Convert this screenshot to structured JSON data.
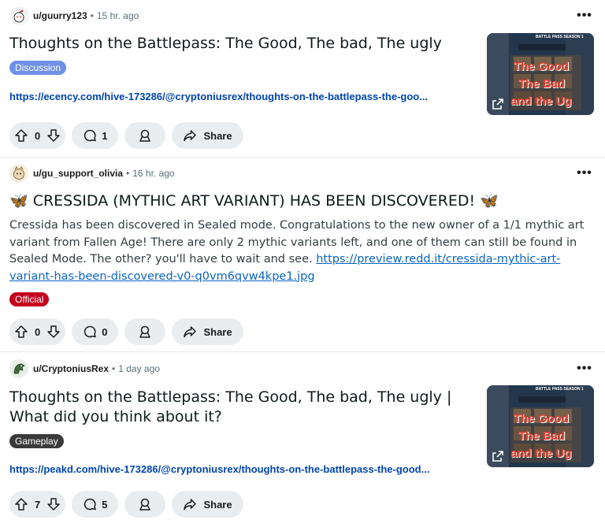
{
  "posts": [
    {
      "username": "u/guurry123",
      "time": "15 hr. ago",
      "title": "Thoughts on the Battlepass: The Good, The bad, The ugly",
      "flair": {
        "label": "Discussion",
        "color": "#6e90e6"
      },
      "link": "https://ecency.com/hive-173286/@cryptoniusrex/thoughts-on-the-battlepass-the-goo...",
      "thumbnail": {
        "banner": "BATTLE PASS SEASON 1",
        "lines": [
          "The Good",
          "The Bad",
          "and the Ug"
        ]
      },
      "votes": "0",
      "comments": "1",
      "share_label": "Share"
    },
    {
      "username": "u/gu_support_olivia",
      "time": "16 hr. ago",
      "title": "🦋 CRESSIDA (MYTHIC ART VARIANT) HAS BEEN DISCOVERED! 🦋",
      "body_text": "Cressida has been discovered in Sealed mode. Congratulations to the new owner of a 1/1 mythic art variant from Fallen Age! There are only 2 mythic variants left, and one of them can still be found in Sealed Mode. The other? you'll have to wait and see. ",
      "body_link": "https://preview.redd.it/cressida-mythic-art-variant-has-been-discovered-v0-q0vm6qvw4kpe1.jpg",
      "flair": {
        "label": "Official",
        "color": "#c4001d"
      },
      "votes": "0",
      "comments": "0",
      "share_label": "Share"
    },
    {
      "username": "u/CryptoniusRex",
      "time": "1 day ago",
      "title": "Thoughts on the Battlepass: The Good, The bad, The ugly | What did you think about it?",
      "flair": {
        "label": "Gameplay",
        "color": "#3b3b3b"
      },
      "link": "https://peakd.com/hive-173286/@cryptoniusrex/thoughts-on-the-battlepass-the-good...",
      "thumbnail": {
        "banner": "BATTLE PASS SEASON 1",
        "lines": [
          "The Good",
          "The Bad",
          "and the Ug"
        ]
      },
      "votes": "7",
      "comments": "5",
      "share_label": "Share"
    }
  ],
  "meta_separator": "•",
  "more_label": "•••",
  "colors": {
    "link": "#0045ac",
    "pill": "#eaedef",
    "divider": "#e5ebee",
    "thumb_text": "#e63b2e"
  },
  "icons": [
    "reddit-avatar-icon",
    "upvote-icon",
    "downvote-icon",
    "comment-icon",
    "award-icon",
    "share-icon",
    "overflow-menu-icon",
    "external-link-icon"
  ]
}
